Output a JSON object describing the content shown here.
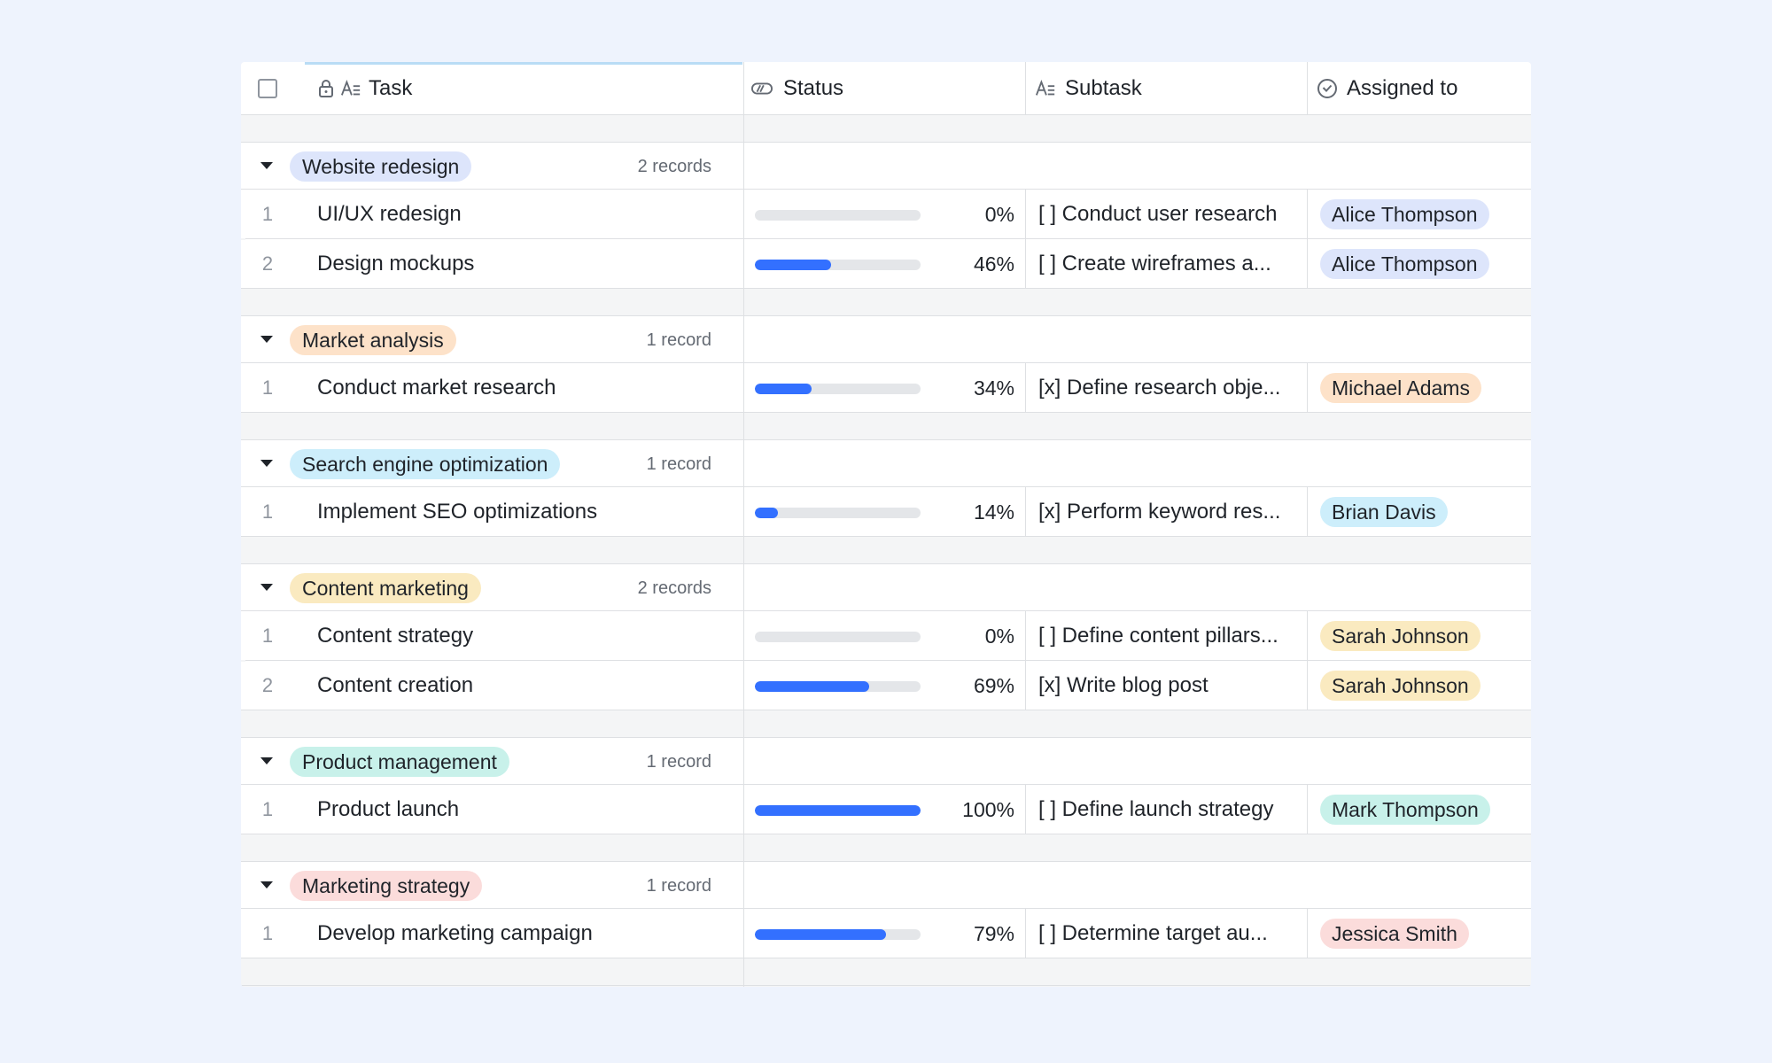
{
  "header": {
    "task": "Task",
    "status": "Status",
    "subtask": "Subtask",
    "assigned": "Assigned to",
    "icons": {
      "select_all": "checkbox-icon",
      "lock": "lock-icon",
      "text_field": "text-field-icon",
      "progress": "progress-icon",
      "person": "person-circle-icon"
    }
  },
  "colors": {
    "progress_fill": "#3370ff",
    "progress_track": "#e4e6e9",
    "blue_tag": "#dde5fb",
    "orange_tag": "#fde2c9",
    "cyan_tag": "#cdeefb",
    "yellow_tag": "#faeac0",
    "teal_tag": "#c8f1ea",
    "red_tag": "#fbdcdb"
  },
  "groups": [
    {
      "name": "Website redesign",
      "count": "2 records",
      "color": "#dde5fb",
      "records": [
        {
          "num": "1",
          "task": "UI/UX redesign",
          "progress": 0,
          "progress_label": "0%",
          "subtask": "[ ] Conduct user research",
          "assignee": "Alice Thompson"
        },
        {
          "num": "2",
          "task": "Design mockups",
          "progress": 46,
          "progress_label": "46%",
          "subtask": "[ ] Create wireframes a...",
          "assignee": "Alice Thompson"
        }
      ]
    },
    {
      "name": "Market analysis",
      "count": "1 record",
      "color": "#fde2c9",
      "records": [
        {
          "num": "1",
          "task": "Conduct market research",
          "progress": 34,
          "progress_label": "34%",
          "subtask": "[x] Define research obje...",
          "assignee": "Michael Adams"
        }
      ]
    },
    {
      "name": "Search engine optimization",
      "count": "1 record",
      "color": "#cdeefb",
      "records": [
        {
          "num": "1",
          "task": "Implement SEO optimizations",
          "progress": 14,
          "progress_label": "14%",
          "subtask": "[x] Perform keyword res...",
          "assignee": "Brian Davis"
        }
      ]
    },
    {
      "name": "Content marketing",
      "count": "2 records",
      "color": "#faeac0",
      "records": [
        {
          "num": "1",
          "task": "Content strategy",
          "progress": 0,
          "progress_label": "0%",
          "subtask": "[ ] Define content pillars...",
          "assignee": "Sarah Johnson"
        },
        {
          "num": "2",
          "task": "Content creation",
          "progress": 69,
          "progress_label": "69%",
          "subtask": "[x] Write blog post",
          "assignee": "Sarah Johnson"
        }
      ]
    },
    {
      "name": "Product management",
      "count": "1 record",
      "color": "#c8f1ea",
      "records": [
        {
          "num": "1",
          "task": "Product launch",
          "progress": 100,
          "progress_label": "100%",
          "subtask": "[ ] Define launch strategy",
          "assignee": "Mark Thompson"
        }
      ]
    },
    {
      "name": "Marketing strategy",
      "count": "1 record",
      "color": "#fbdcdb",
      "records": [
        {
          "num": "1",
          "task": "Develop marketing campaign",
          "progress": 79,
          "progress_label": "79%",
          "subtask": "[ ] Determine target au...",
          "assignee": "Jessica Smith"
        }
      ]
    }
  ]
}
